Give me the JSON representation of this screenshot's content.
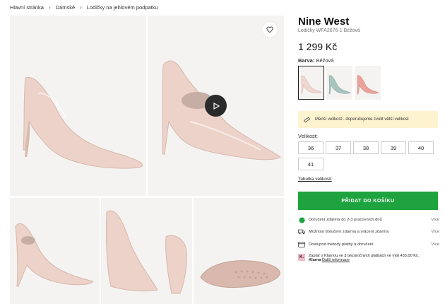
{
  "breadcrumb": {
    "items": [
      "Hlavní stránka",
      "Dámské",
      "Lodičky na jehlovém podpatku"
    ]
  },
  "product": {
    "brand": "Nine West",
    "subtitle": "Lodičky WFA2676-1 Béžová",
    "price": "1 299 Kč",
    "color_label": "Barva:",
    "color_value": "Béžová",
    "swatches": [
      {
        "color": "#f0d6cf",
        "selected": true
      },
      {
        "color": "#a9c4bf",
        "selected": false
      },
      {
        "color": "#e9a39a",
        "selected": false
      }
    ]
  },
  "notice": {
    "text": "Menší velikost - doporučujeme zvolit větší velikost"
  },
  "sizes": {
    "title": "Velikost:",
    "options": [
      "36",
      "37",
      "38",
      "39",
      "40",
      "41"
    ]
  },
  "size_table_link": "Tabulka velikostí",
  "add_to_cart": "PŘIDAT DO KOŠÍKU",
  "info": [
    {
      "icon": "green-dot-icon",
      "text": "Doručení zdarma do 2-3 pracovních dnů",
      "more": "Více"
    },
    {
      "icon": "truck-icon",
      "text": "Možnost doručení zdarma a vrácení zdarma",
      "more": "Více"
    },
    {
      "icon": "card-icon",
      "text": "Dostupné metody platby a doručení",
      "more": "Více"
    }
  ],
  "klarna": {
    "logo": "K.",
    "text": "Zaplať s Klarnou ve 3 bezúročných platbách ve výši 433,00 Kč.",
    "brand": "Klarna",
    "link": "Další informace"
  },
  "colors": {
    "accent": "#1ea33f",
    "notice_bg": "#fdf3cf",
    "shoe": "#ecd2c8",
    "tile_bg": "#f4f3f2"
  }
}
